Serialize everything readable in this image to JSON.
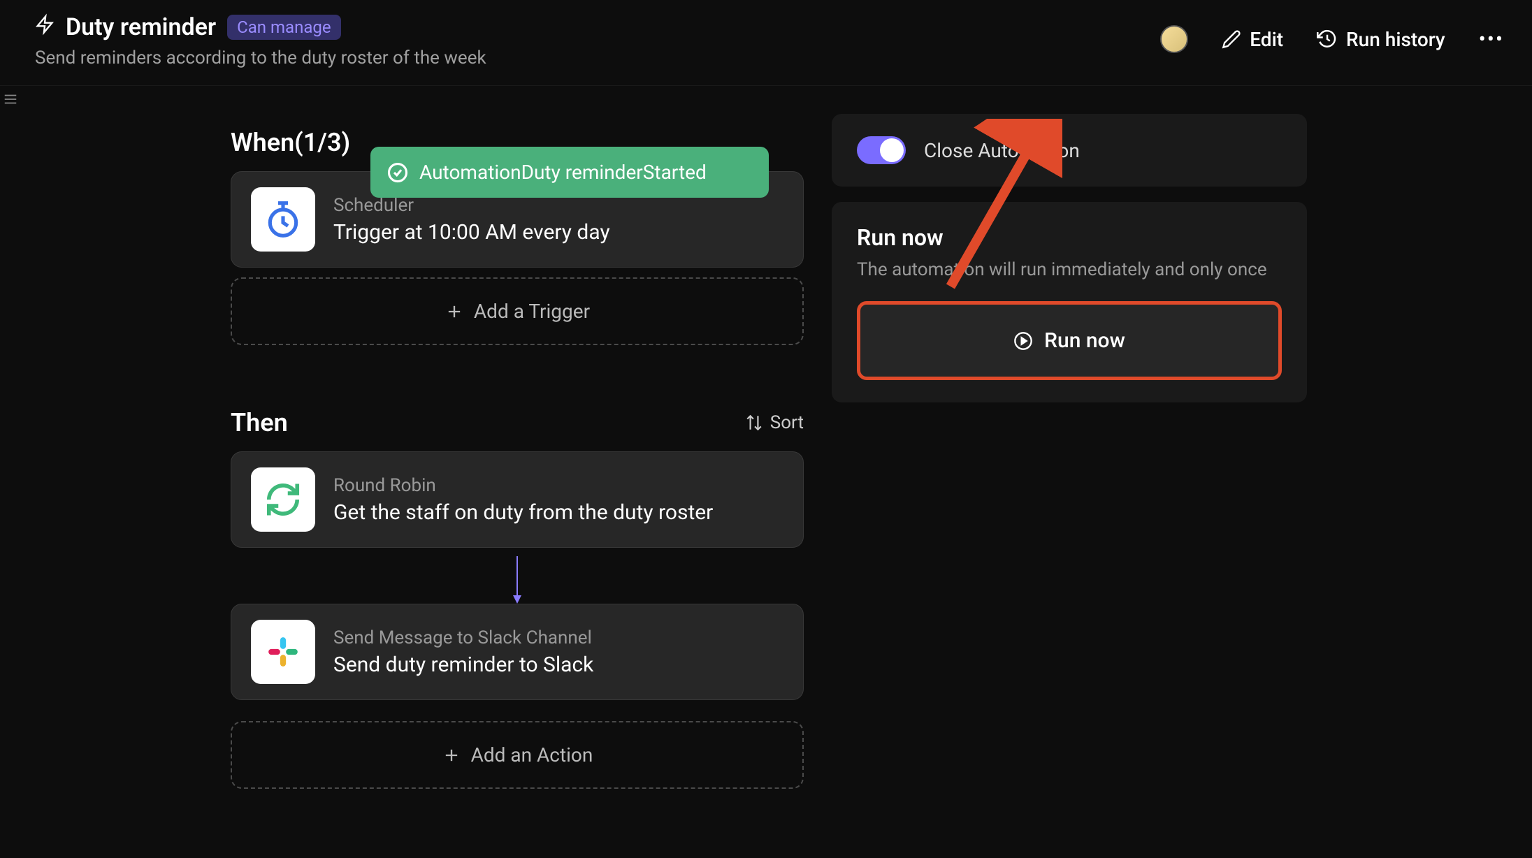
{
  "header": {
    "title": "Duty reminder",
    "permission": "Can manage",
    "subtitle": "Send reminders according to the duty roster of the week",
    "edit_label": "Edit",
    "run_history_label": "Run history"
  },
  "toast": {
    "text": "AutomationDuty reminderStarted"
  },
  "when": {
    "title": "When(1/3)",
    "trigger": {
      "label": "Scheduler",
      "desc": "Trigger at 10:00 AM every day"
    },
    "add_label": "Add a Trigger"
  },
  "then": {
    "title": "Then",
    "sort_label": "Sort",
    "actions": [
      {
        "label": "Round Robin",
        "desc": "Get the staff on duty from the duty roster"
      },
      {
        "label": "Send Message to Slack Channel",
        "desc": "Send duty reminder to Slack"
      }
    ],
    "add_label": "Add an Action"
  },
  "side": {
    "toggle_label": "Close Automation",
    "run_title": "Run now",
    "run_sub": "The automation will run immediately and only once",
    "run_btn": "Run now"
  }
}
